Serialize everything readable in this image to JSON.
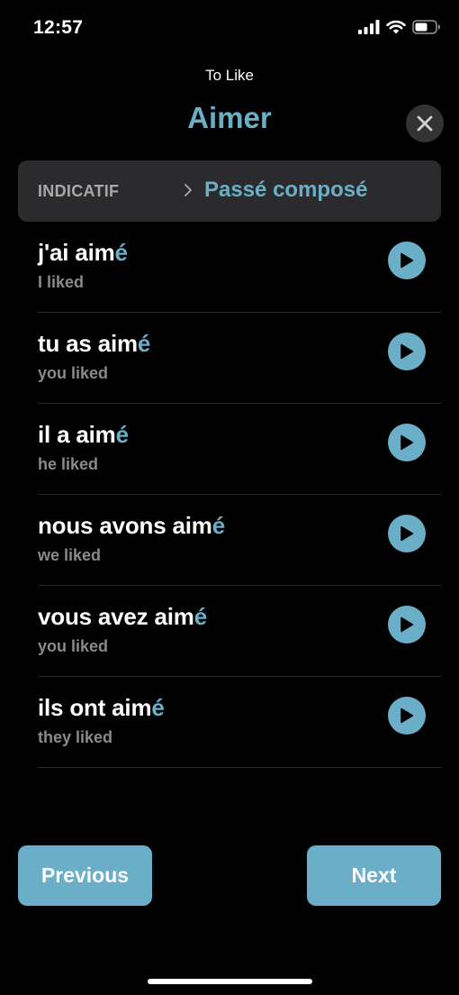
{
  "status": {
    "time": "12:57"
  },
  "header": {
    "subtitle": "To Like",
    "title": "Aimer"
  },
  "tense_bar": {
    "mood": "INDICATIF",
    "tense": "Passé composé"
  },
  "conjugations": [
    {
      "stem": "j'ai aim",
      "ending": "é",
      "translation": "I liked"
    },
    {
      "stem": "tu as aim",
      "ending": "é",
      "translation": "you liked"
    },
    {
      "stem": "il a aim",
      "ending": "é",
      "translation": "he liked"
    },
    {
      "stem": "nous avons aim",
      "ending": "é",
      "translation": "we liked"
    },
    {
      "stem": "vous avez aim",
      "ending": "é",
      "translation": "you liked"
    },
    {
      "stem": "ils ont aim",
      "ending": "é",
      "translation": "they liked"
    }
  ],
  "buttons": {
    "previous": "Previous",
    "next": "Next"
  },
  "colors": {
    "accent": "#6aaec7",
    "background": "#000000",
    "panel": "#2b2b2d"
  },
  "icons": {
    "close": "close-icon",
    "play": "play-icon",
    "chevron": "chevron-right-icon"
  }
}
